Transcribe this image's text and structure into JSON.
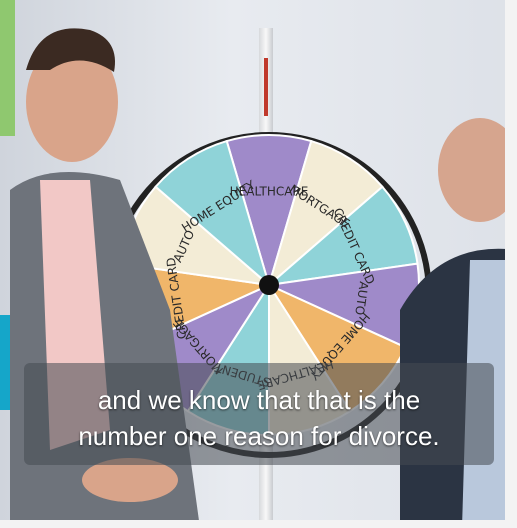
{
  "caption": {
    "line1": "and we know that that is the",
    "line2": "number one reason for divorce."
  },
  "wheel": {
    "segments": [
      {
        "label": "HEALTHCARE",
        "color": "#9f8ac9"
      },
      {
        "label": "MORTGAGE",
        "color": "#f3ecd6"
      },
      {
        "label": "CREDIT CARD",
        "color": "#8fd3d8"
      },
      {
        "label": "AUTO",
        "color": "#9f8ac9"
      },
      {
        "label": "HOME EQUITY",
        "color": "#f0b66a"
      },
      {
        "label": "HEALTHCARE",
        "color": "#f3ecd6"
      },
      {
        "label": "STUDENT",
        "color": "#8fd3d8"
      },
      {
        "label": "MORTGAGE",
        "color": "#9f8ac9"
      },
      {
        "label": "CREDIT CARD",
        "color": "#f0b66a"
      },
      {
        "label": "AUTO",
        "color": "#f3ecd6"
      },
      {
        "label": "HOME EQUITY",
        "color": "#8fd3d8"
      }
    ]
  },
  "colors": {
    "accent_green": "#8fc86f",
    "accent_blue": "#15a6c9",
    "caption_bg": "rgba(70,74,82,0.55)"
  }
}
